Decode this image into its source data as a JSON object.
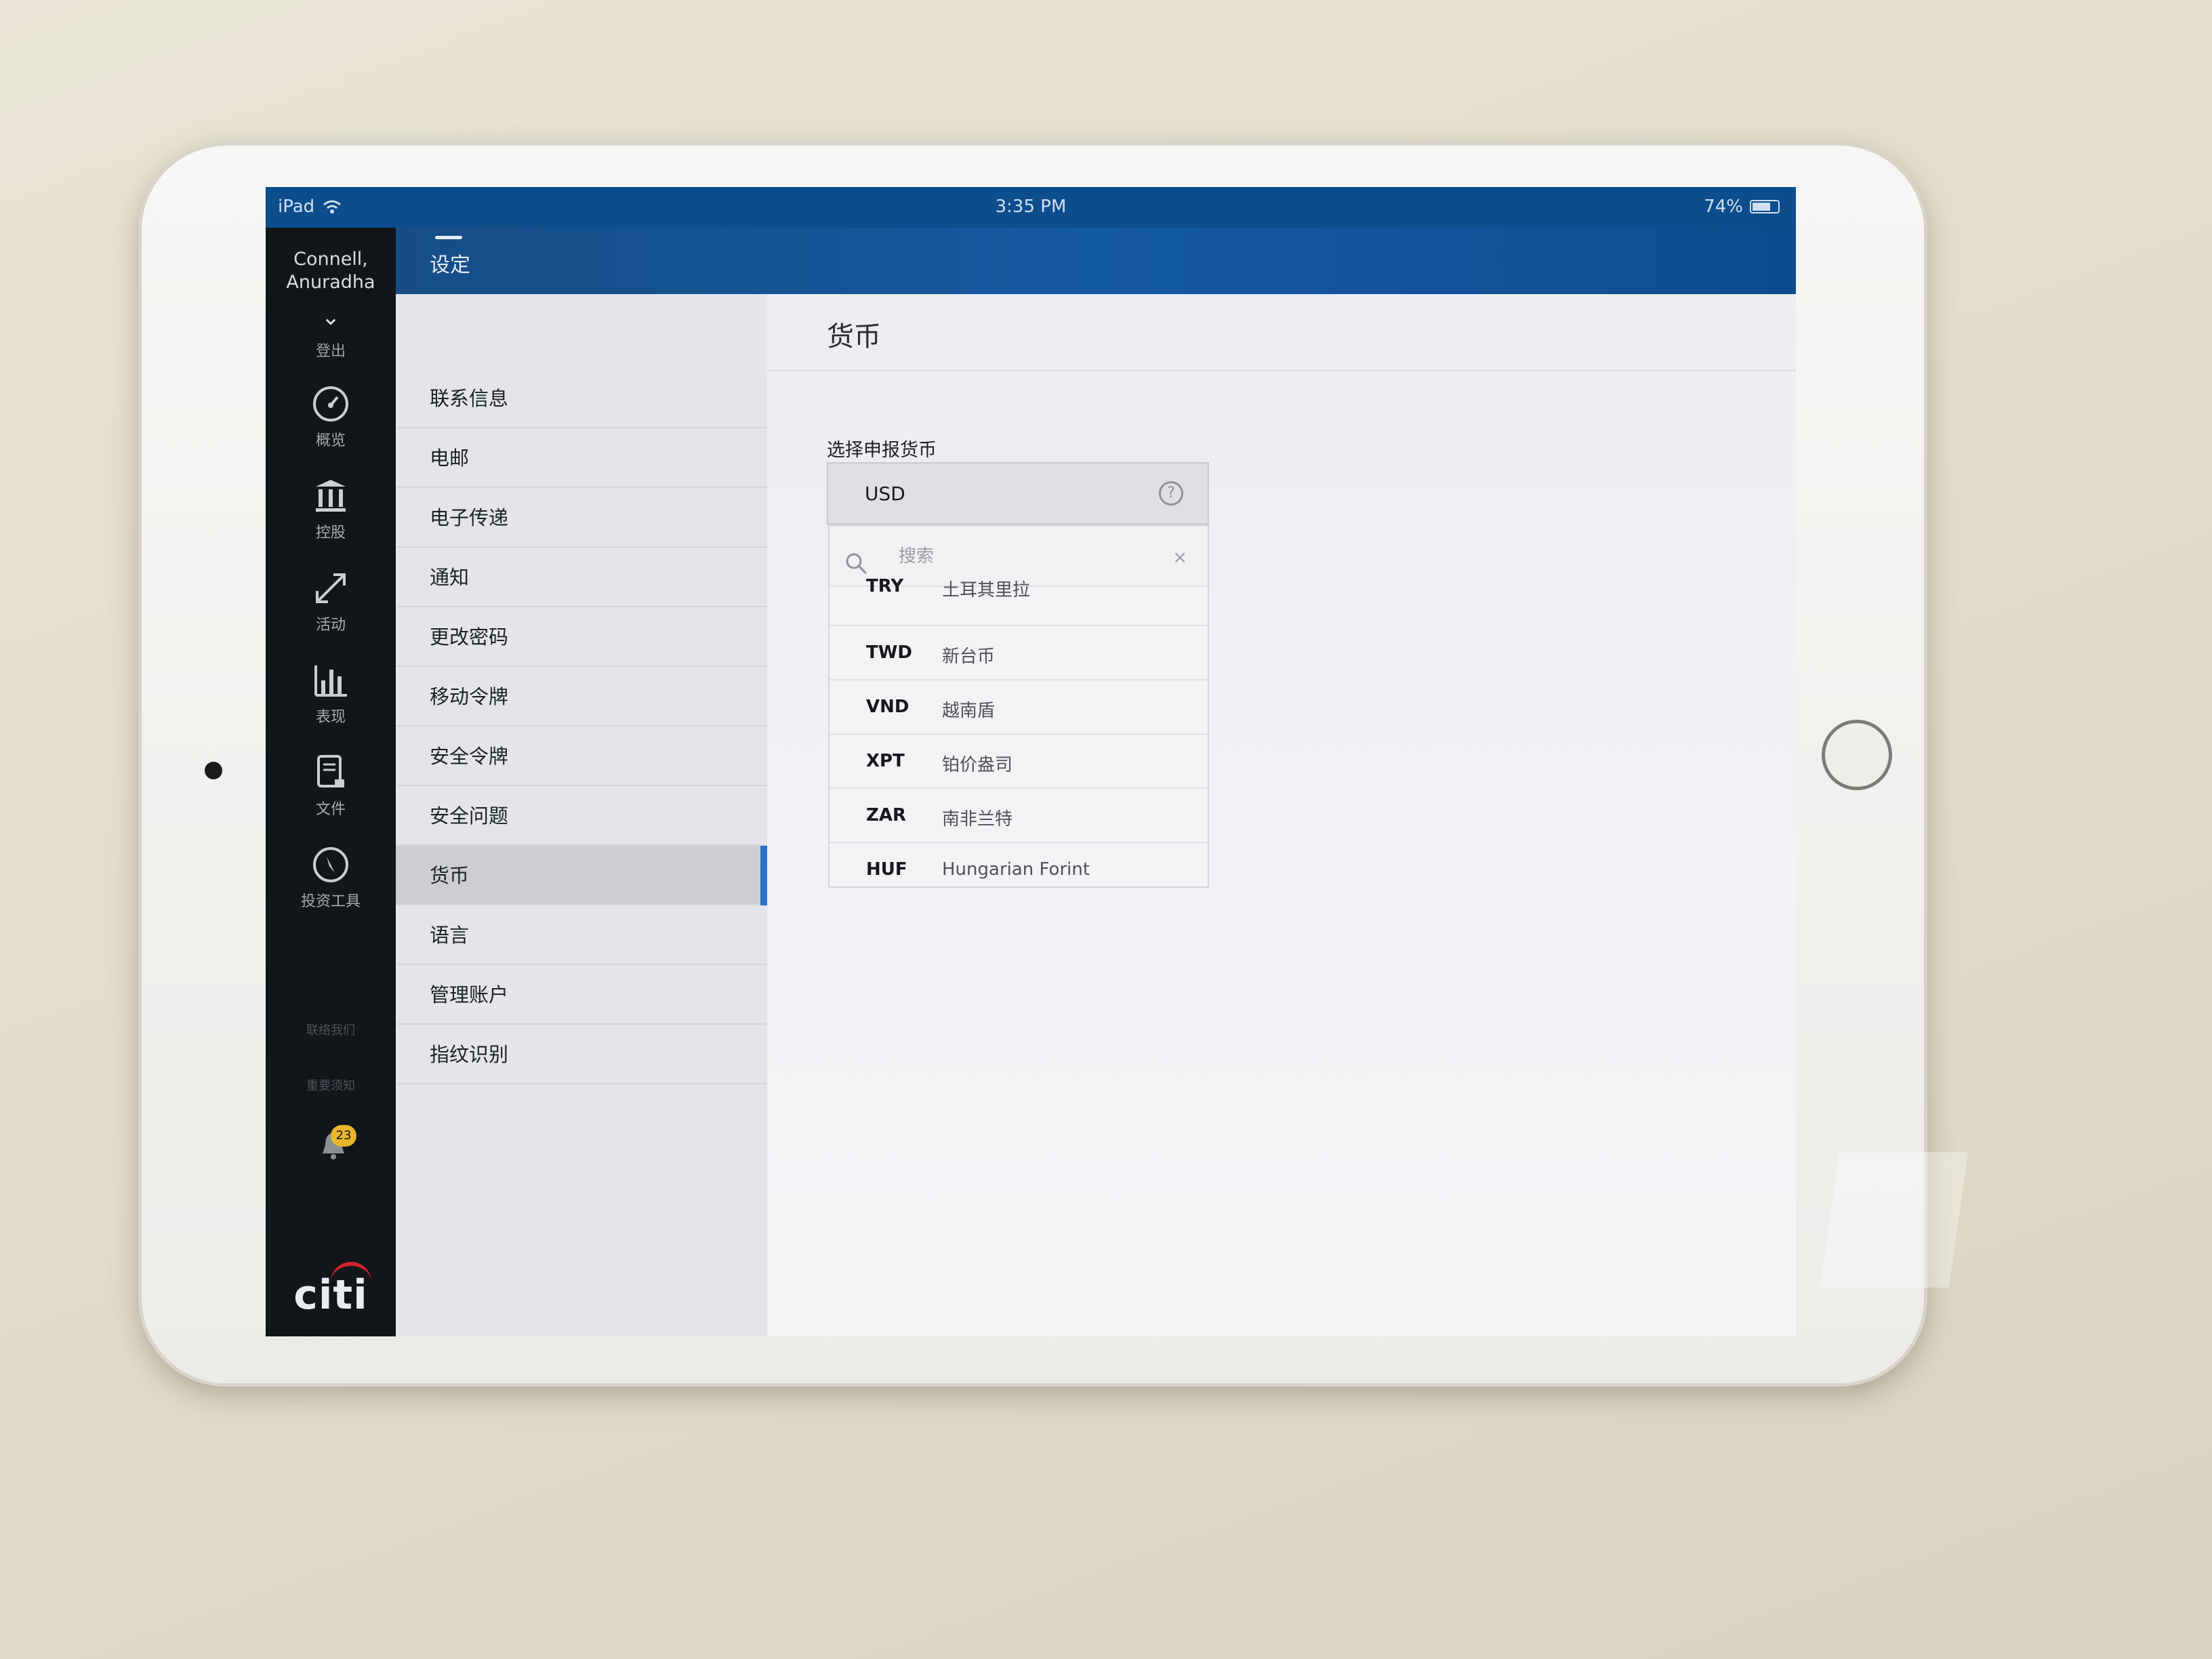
{
  "status_bar": {
    "device": "iPad",
    "time": "3:35 PM",
    "battery": "74%",
    "battery_level": 0.74
  },
  "user": {
    "name_line1": "Connell,",
    "name_line2": "Anuradha",
    "logout": "登出"
  },
  "nav": {
    "items": [
      {
        "label": "概览",
        "icon": "speedometer-icon"
      },
      {
        "label": "控股",
        "icon": "bank-icon"
      },
      {
        "label": "活动",
        "icon": "arrows-diagonal-icon"
      },
      {
        "label": "表现",
        "icon": "bar-chart-icon"
      },
      {
        "label": "文件",
        "icon": "document-lock-icon"
      },
      {
        "label": "投资工具",
        "icon": "compass-icon"
      }
    ],
    "contact": "联络我们",
    "notice": "重要须知",
    "notification_count": "23",
    "logo": "citi"
  },
  "header": {
    "title": "设定"
  },
  "settings": {
    "items": [
      "联系信息",
      "电邮",
      "电子传递",
      "通知",
      "更改密码",
      "移动令牌",
      "安全令牌",
      "安全问题",
      "货币",
      "语言",
      "管理账户",
      "指纹识别"
    ],
    "active_index": 8
  },
  "content": {
    "title": "货币",
    "field_label": "选择申报货币",
    "selected_currency": "USD",
    "search_placeholder": "搜索",
    "currencies": [
      {
        "code": "TRY",
        "name": "土耳其里拉"
      },
      {
        "code": "TWD",
        "name": "新台币"
      },
      {
        "code": "VND",
        "name": "越南盾"
      },
      {
        "code": "XPT",
        "name": "铂价盎司"
      },
      {
        "code": "ZAR",
        "name": "南非兰特"
      },
      {
        "code": "HUF",
        "name": "Hungarian Forint"
      }
    ]
  },
  "colors": {
    "header_blue": "#1359a0",
    "accent_blue": "#2a73c9",
    "sidebar_dark": "#121619",
    "badge_yellow": "#e8b62a",
    "citi_red": "#d3232a"
  }
}
